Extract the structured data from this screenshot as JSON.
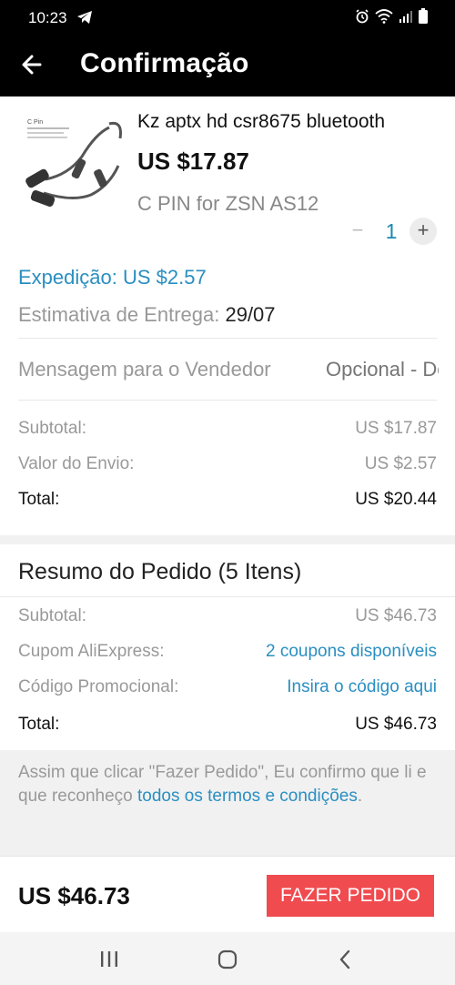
{
  "status_bar": {
    "time": "10:23",
    "icons": [
      "telegram-icon",
      "alarm-icon",
      "wifi-icon",
      "signal-icon",
      "battery-icon"
    ]
  },
  "header": {
    "title": "Confirmação",
    "back_icon": "arrow-left-icon"
  },
  "product": {
    "thumbnail_label": "C Pin",
    "name": "Kz aptx hd csr8675 bluetooth",
    "price": "US $17.87",
    "variant": "C PIN for ZSN AS12",
    "quantity": "1",
    "minus": "−",
    "plus": "+"
  },
  "shipping": {
    "label": "Expedição: US $2.57",
    "delivery_label": "Estimativa de Entrega:",
    "delivery_date": "29/07"
  },
  "message": {
    "label": "Mensagem para o Vendedor",
    "placeholder": "Opcional - Deixe uma mensagem"
  },
  "item_totals": {
    "subtotal_label": "Subtotal:",
    "subtotal_value": "US $17.87",
    "shipping_label": "Valor do Envio:",
    "shipping_value": "US $2.57",
    "total_label": "Total:",
    "total_value": "US $20.44"
  },
  "summary": {
    "title": "Resumo do Pedido (5 Itens)",
    "subtotal_label": "Subtotal:",
    "subtotal_value": "US $46.73",
    "coupon_label": "Cupom AliExpress:",
    "coupon_value": "2 coupons disponíveis",
    "promo_label": "Código Promocional:",
    "promo_value": "Insira o código aqui",
    "total_label": "Total:",
    "total_value": "US $46.73"
  },
  "terms": {
    "text": "Assim que clicar \"Fazer Pedido\", Eu confirmo que li e que reconheço ",
    "link": "todos os termos e condições",
    "end": "."
  },
  "footer": {
    "total": "US $46.73",
    "button": "FAZER PEDIDO"
  },
  "colors": {
    "accent_link": "#2a8fc1",
    "button": "#f04b4f",
    "header_bg": "#000000"
  }
}
